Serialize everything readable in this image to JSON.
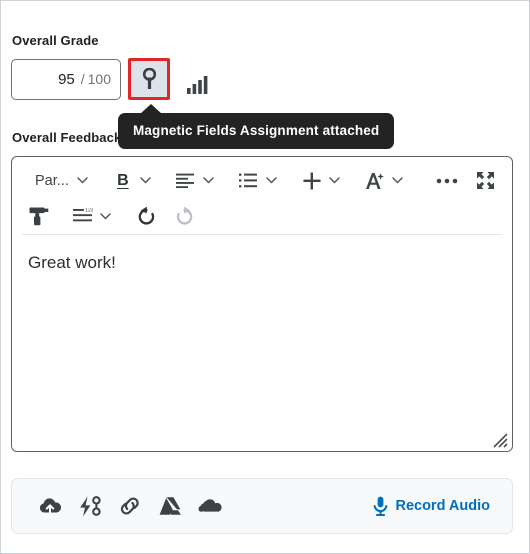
{
  "grade": {
    "label": "Overall Grade",
    "score": "95",
    "separator": "/",
    "max": "100",
    "attach_icon": "key-icon",
    "stats_icon": "bar-chart-statistics-icon"
  },
  "tooltip": {
    "text": "Magnetic Fields Assignment attached"
  },
  "feedback": {
    "label": "Overall Feedback",
    "content": "Great work!"
  },
  "toolbar": {
    "row1": [
      {
        "name": "paragraph-format-dropdown",
        "label": "Par...",
        "icon": "text-label",
        "caret": true
      },
      {
        "name": "bold-button",
        "label": "B",
        "icon": "bold-icon",
        "caret": true
      },
      {
        "name": "align-left-button",
        "label": "",
        "icon": "align-left-icon",
        "caret": true
      },
      {
        "name": "bulleted-list-button",
        "label": "",
        "icon": "bulleted-list-icon",
        "caret": true
      },
      {
        "name": "insert-button",
        "label": "",
        "icon": "plus-icon",
        "caret": true
      },
      {
        "name": "font-style-button",
        "label": "",
        "icon": "font-style-sparkle-icon",
        "caret": true
      },
      {
        "name": "more-options-button",
        "label": "",
        "icon": "ellipsis-icon",
        "caret": false
      },
      {
        "name": "fullscreen-button",
        "label": "",
        "icon": "expand-fullscreen-icon",
        "caret": false
      }
    ],
    "row2": [
      {
        "name": "format-painter-button",
        "icon": "format-painter-icon",
        "caret": false
      },
      {
        "name": "line-numbering-button",
        "icon": "numbered-lines-icon",
        "caret": true
      },
      {
        "name": "undo-button",
        "icon": "undo-icon",
        "caret": false,
        "disabled": false
      },
      {
        "name": "redo-button",
        "icon": "redo-icon",
        "caret": false,
        "disabled": true
      }
    ]
  },
  "attachments": {
    "icons": [
      {
        "name": "upload-cloud-icon",
        "title": "Upload"
      },
      {
        "name": "quicklink-lightning-icon",
        "title": "Quicklink"
      },
      {
        "name": "link-icon",
        "title": "Link"
      },
      {
        "name": "google-drive-icon",
        "title": "Google Drive"
      },
      {
        "name": "onedrive-cloud-icon",
        "title": "OneDrive"
      }
    ],
    "record_audio_label": "Record Audio",
    "record_audio_icon": "microphone-icon"
  },
  "colors": {
    "highlight_border": "#e02626",
    "highlight_fill": "#dde3ea",
    "tooltip_bg": "#232323",
    "link_blue": "#006fbf",
    "text_dark": "#202122",
    "icon_gray": "#3f4547",
    "disabled_gray": "#b9bcc0"
  }
}
